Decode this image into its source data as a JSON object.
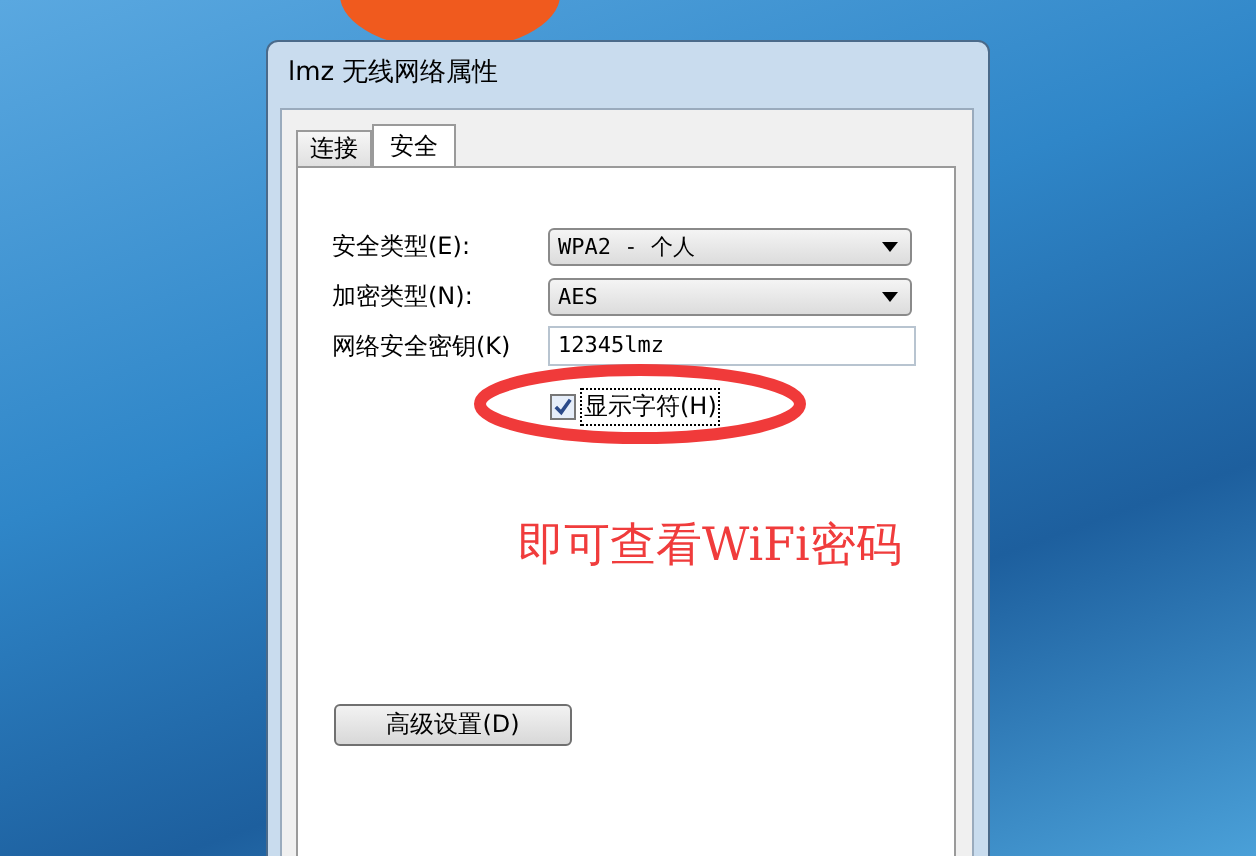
{
  "window": {
    "title": "lmz 无线网络属性"
  },
  "tabs": [
    {
      "label": "连接",
      "selected": false
    },
    {
      "label": "安全",
      "selected": true
    }
  ],
  "fields": [
    {
      "kind": "dropdown",
      "label": "安全类型(E):",
      "value": "WPA2 - 个人"
    },
    {
      "kind": "dropdown",
      "label": "加密类型(N):",
      "value": "AES"
    },
    {
      "kind": "text",
      "label": "网络安全密钥(K)",
      "value": "12345lmz"
    }
  ],
  "show_characters": {
    "label": "显示字符(H)",
    "checked": true
  },
  "annotation": {
    "text": "即可查看WiFi密码"
  },
  "advanced_button": {
    "label": "高级设置(D)"
  }
}
